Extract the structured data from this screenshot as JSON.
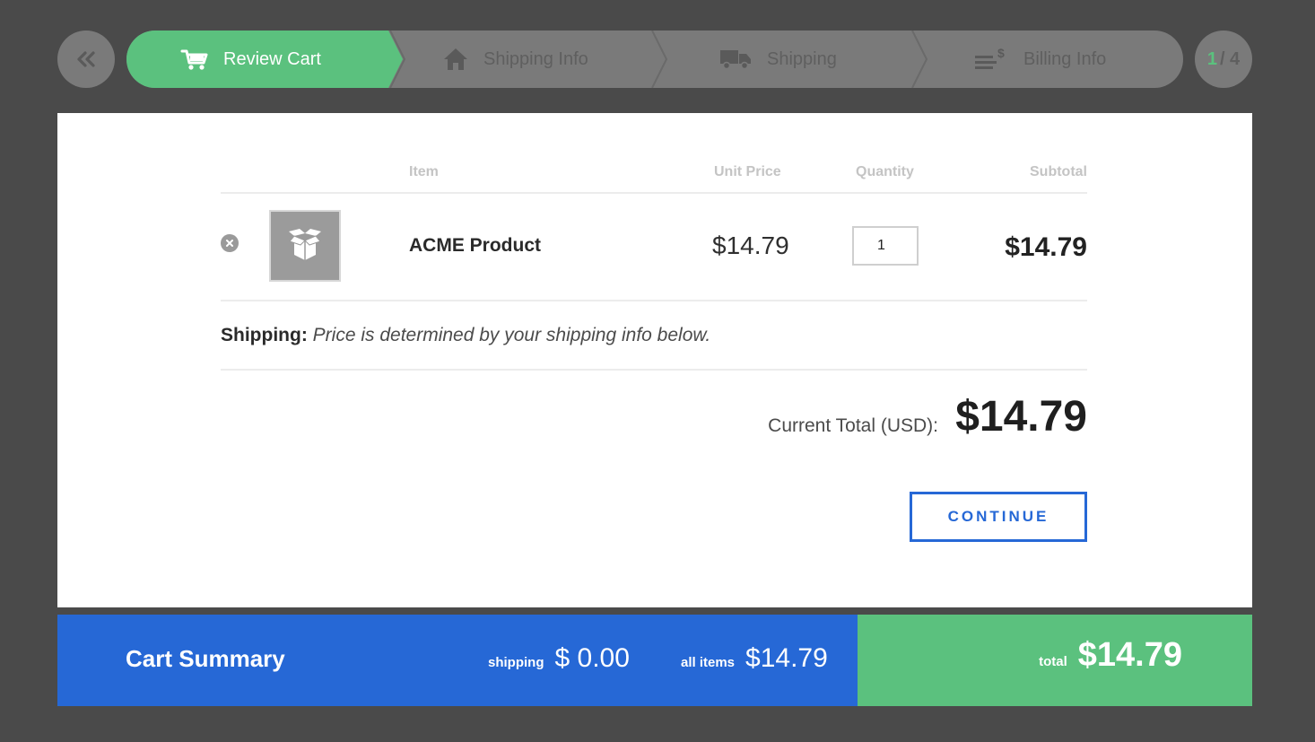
{
  "stepper": {
    "back_icon": "double-chevron-left-icon",
    "steps": [
      {
        "label": "Review Cart",
        "icon": "cart-icon",
        "active": true
      },
      {
        "label": "Shipping Info",
        "icon": "home-icon",
        "active": false
      },
      {
        "label": "Shipping",
        "icon": "truck-icon",
        "active": false
      },
      {
        "label": "Billing Info",
        "icon": "billing-icon",
        "active": false
      }
    ],
    "page_current": "1",
    "page_total": "/ 4"
  },
  "cart": {
    "columns": {
      "item": "Item",
      "unit_price": "Unit Price",
      "quantity": "Quantity",
      "subtotal": "Subtotal"
    },
    "items": [
      {
        "name": "ACME Product",
        "unit_price": "$14.79",
        "quantity": "1",
        "subtotal": "$14.79",
        "image_icon": "box-icon"
      }
    ],
    "shipping_label": "Shipping:",
    "shipping_message": "Price is determined by your shipping info below.",
    "total_label": "Current Total (USD):",
    "total_value": "$14.79",
    "continue_label": "CONTINUE"
  },
  "summary": {
    "title": "Cart Summary",
    "shipping_label": "shipping",
    "shipping_value": "$ 0.00",
    "items_label": "all items",
    "items_value": "$14.79",
    "total_label": "total",
    "total_value": "$14.79"
  },
  "colors": {
    "background": "#4a4a4a",
    "stepper_inactive": "#7a7a7a",
    "accent_green": "#5bc17e",
    "accent_blue": "#2668d6"
  }
}
